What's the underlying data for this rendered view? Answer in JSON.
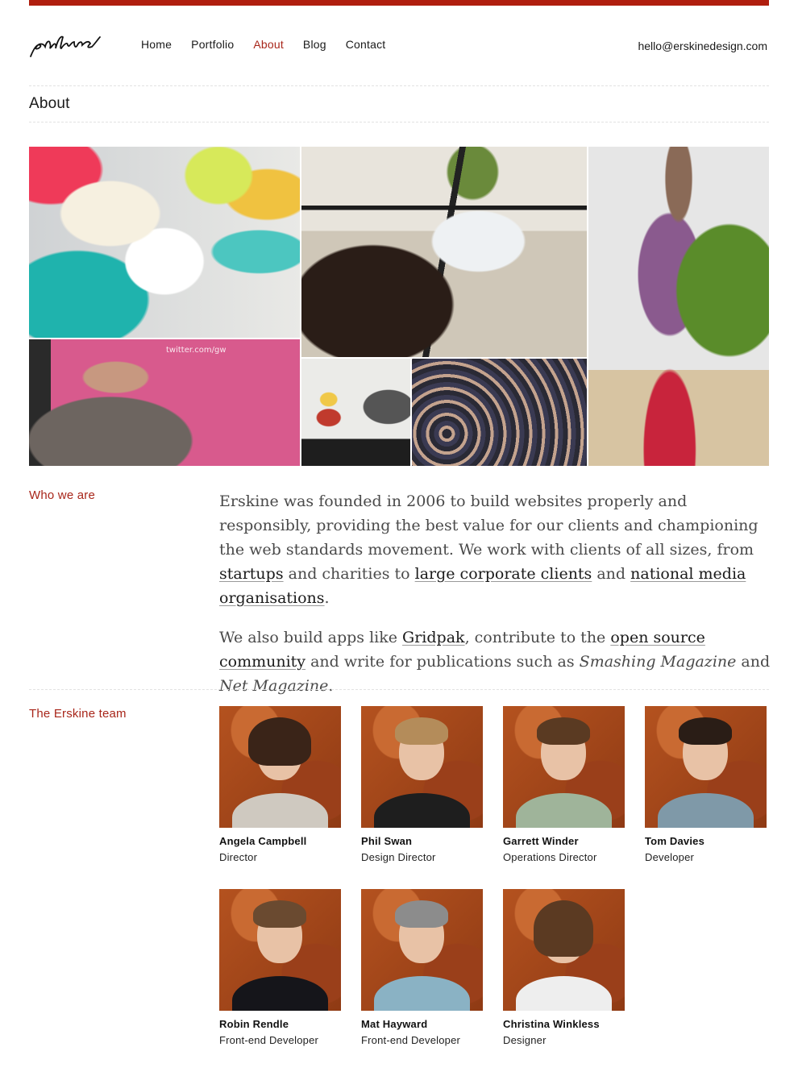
{
  "brand": {
    "accent": "#a8261a",
    "bar_color": "#b01e0e",
    "logo_text": "erskine"
  },
  "nav": {
    "items": [
      {
        "label": "Home",
        "active": false
      },
      {
        "label": "Portfolio",
        "active": false
      },
      {
        "label": "About",
        "active": true
      },
      {
        "label": "Blog",
        "active": false
      },
      {
        "label": "Contact",
        "active": false
      }
    ],
    "email": "hello@erskinedesign.com"
  },
  "page": {
    "title": "About"
  },
  "photo_caption": {
    "speaker_slide": "twitter.com/gw"
  },
  "who": {
    "label": "Who we are",
    "p1": {
      "t1": "Erskine was founded in 2006 to build websites properly and responsibly, providing the best value for our clients and championing the web standards movement. We work with clients of all sizes, from ",
      "l1": "startups",
      "t2": " and charities to ",
      "l2": "large corporate clients",
      "t3": " and ",
      "l3": "national media organisations",
      "t4": "."
    },
    "p2": {
      "t1": "We also build apps like ",
      "l1": "Gridpak",
      "t2": ", contribute to the ",
      "l2": "open source community",
      "t3": " and write for publications such as ",
      "e1": "Smashing Magazine",
      "t4": " and ",
      "e2": "Net Magazine",
      "t5": "."
    }
  },
  "team": {
    "label": "The Erskine team",
    "members": [
      {
        "name": "Angela Campbell",
        "role": "Director"
      },
      {
        "name": "Phil Swan",
        "role": "Design Director"
      },
      {
        "name": "Garrett Winder",
        "role": "Operations Director"
      },
      {
        "name": "Tom Davies",
        "role": "Developer"
      },
      {
        "name": "Robin Rendle",
        "role": "Front-end Developer"
      },
      {
        "name": "Mat Hayward",
        "role": "Front-end Developer"
      },
      {
        "name": "Christina Winkless",
        "role": "Designer"
      }
    ]
  }
}
